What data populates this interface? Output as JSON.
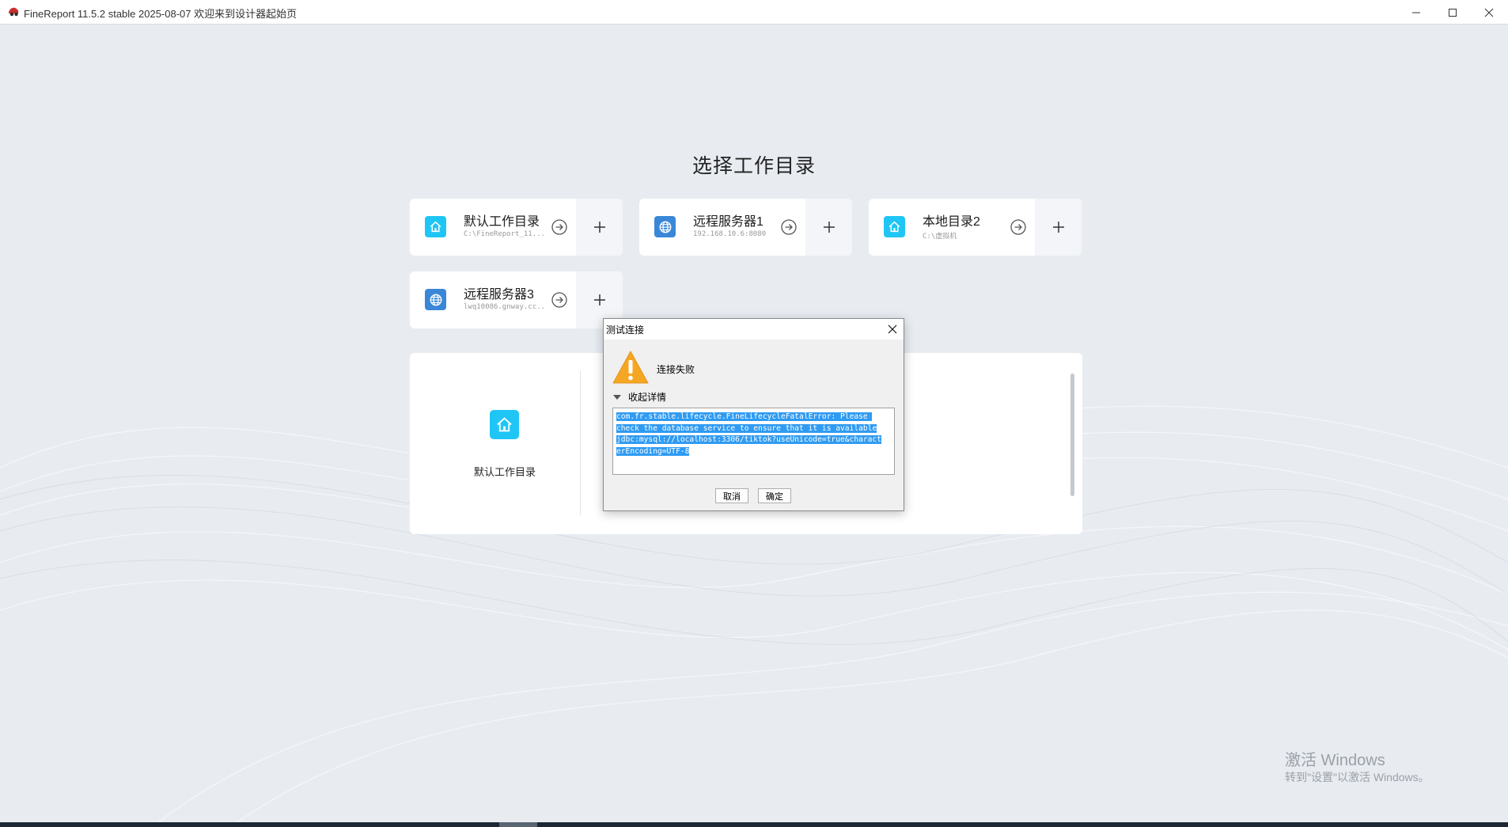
{
  "window": {
    "title": "FineReport 11.5.2 stable 2025-08-07 欢迎来到设计器起始页",
    "minimize_icon": "minimize-icon",
    "maximize_icon": "maximize-icon",
    "close_icon": "close-icon"
  },
  "main": {
    "heading": "选择工作目录",
    "cards": [
      {
        "name": "默认工作目录",
        "path": "C:\\FineReport_11....",
        "icon": "home-icon"
      },
      {
        "name": "远程服务器1",
        "path": "192.168.10.6:8080",
        "icon": "globe-icon"
      },
      {
        "name": "本地目录2",
        "path": "C:\\虚拟机",
        "icon": "home-icon"
      },
      {
        "name": "远程服务器3",
        "path": "lwq10086.gnway.cc...",
        "icon": "globe-icon"
      }
    ],
    "panel": {
      "label": "默认工作目录"
    }
  },
  "dialog": {
    "title": "测试连接",
    "message": "连接失败",
    "detail_toggle": "收起详情",
    "detail_lines": [
      "com.fr.stable.lifecycle.FineLifecycleFatalError: Please ",
      "check the database service to ensure that it is available",
      "jdbc:mysql://localhost:3306/tiktok?useUnicode=true&charact",
      "erEncoding=UTF-8"
    ],
    "cancel_label": "取消",
    "ok_label": "确定"
  },
  "watermark": {
    "line1": "激活 Windows",
    "line2": "转到\"设置\"以激活 Windows。"
  },
  "colors": {
    "background": "#e8ecf1",
    "home_icon": "#1fc6f5",
    "globe_icon": "#3a87d8",
    "selection": "#2f9bf2",
    "warning": "#f5a623"
  }
}
